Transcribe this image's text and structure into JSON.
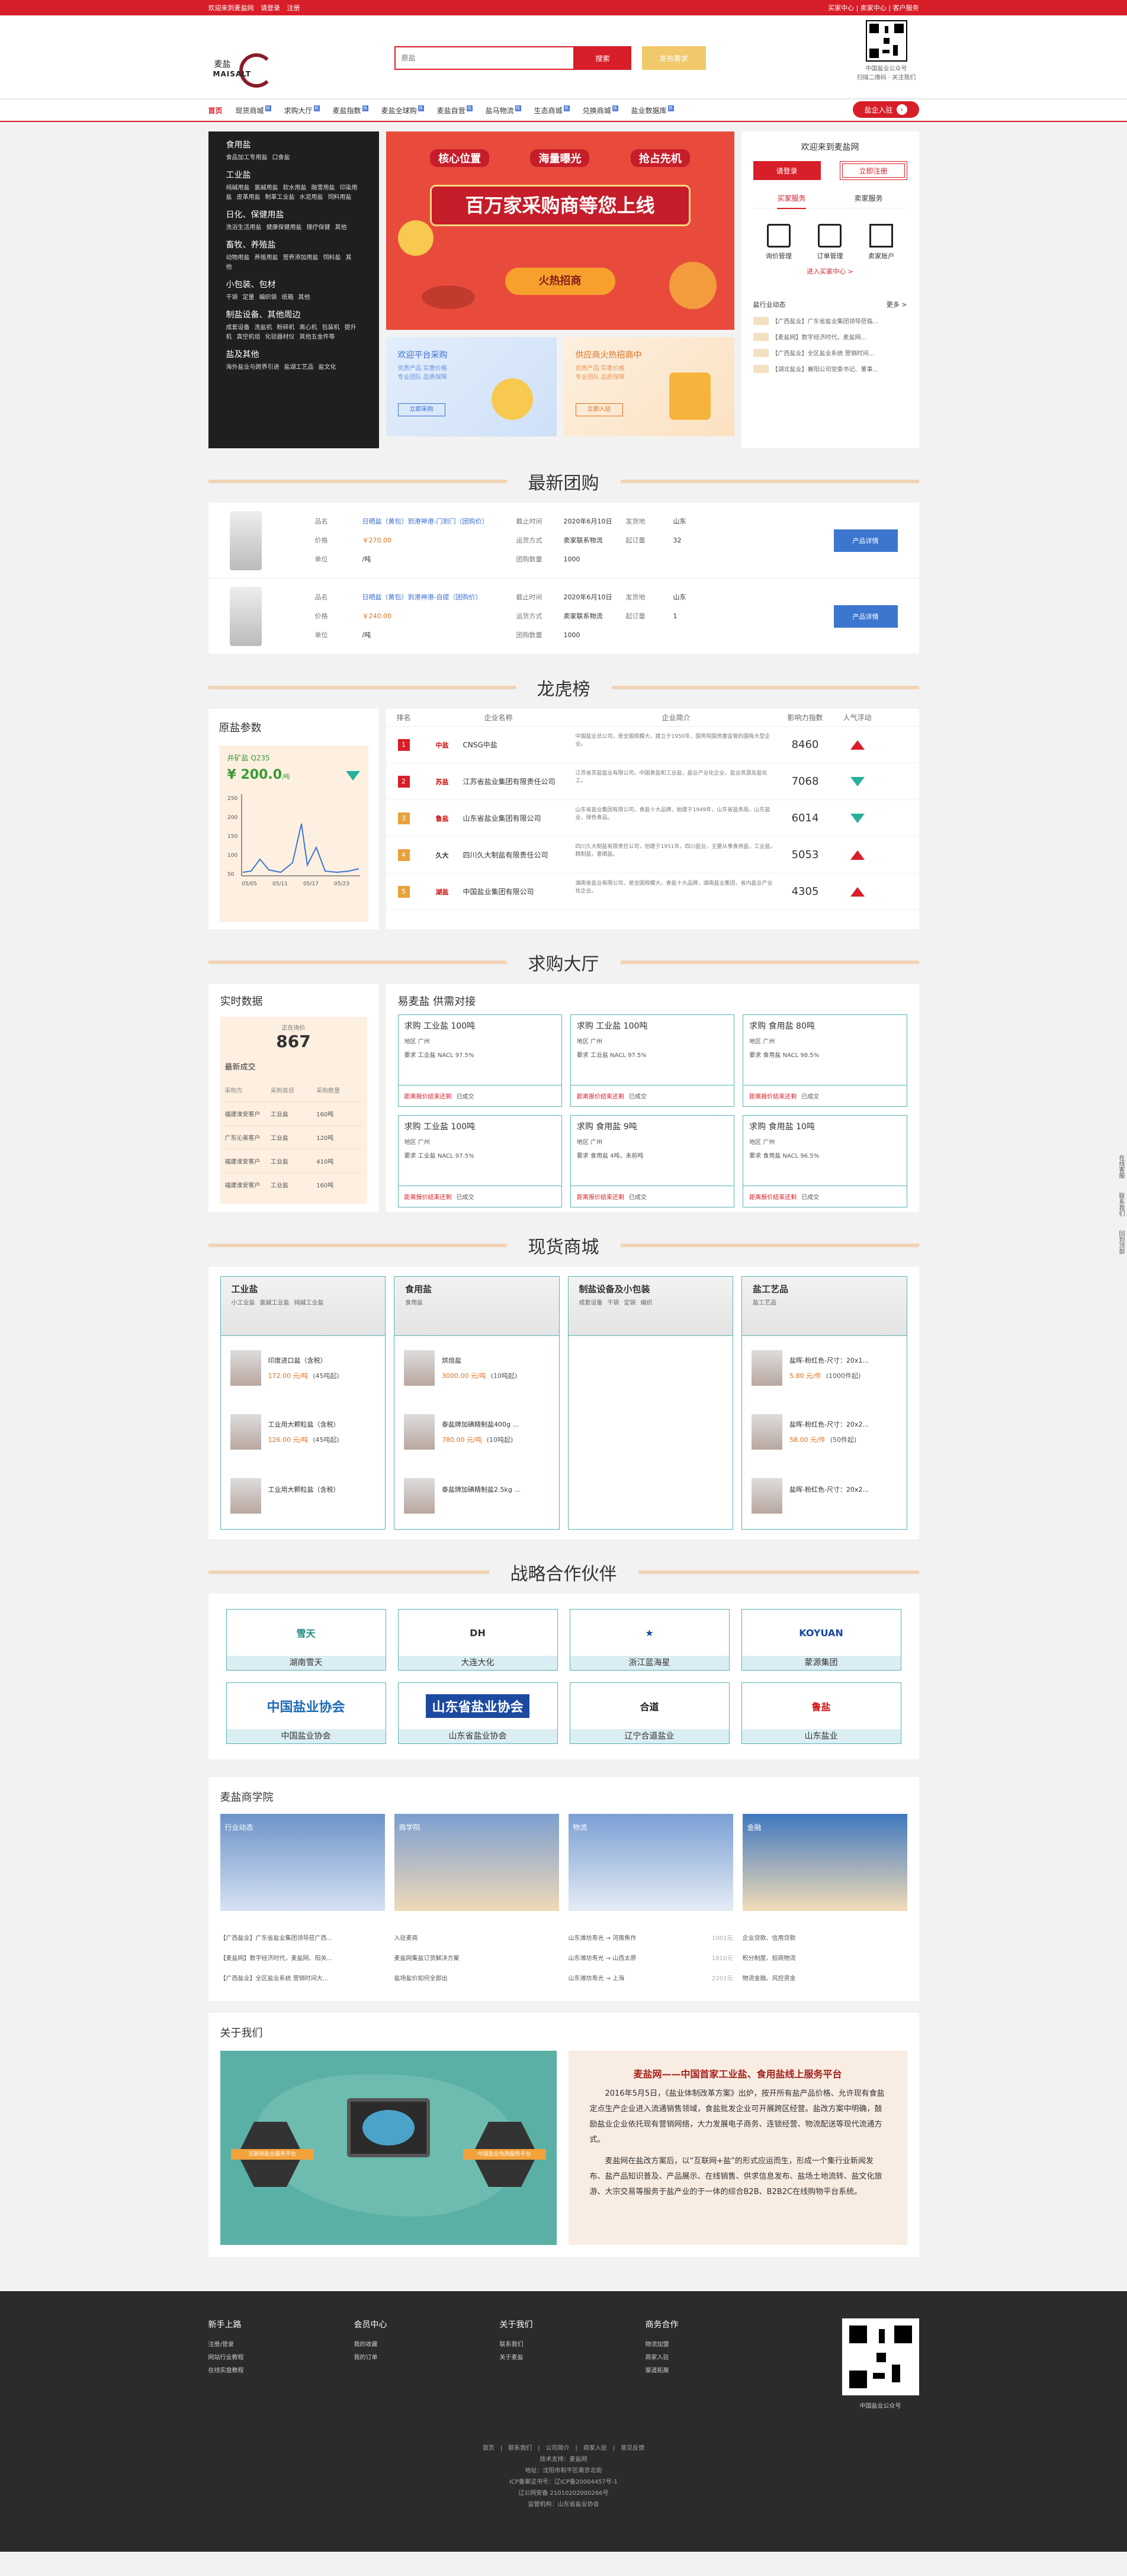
{
  "topbar": {
    "welcome": "欢迎来到麦盐网",
    "login": "请登录",
    "register": "注册",
    "right_links": "买家中心 | 卖家中心 | 客户服务"
  },
  "header": {
    "logo_cn": "麦盐",
    "logo_en": "MAISALT",
    "search_placeholder": "原盐",
    "search_btn": "搜索",
    "publish_btn": "发布需求",
    "qr_caption1": "中国盐业公众号",
    "qr_caption2": "扫描二维码 · 关注我们"
  },
  "nav": {
    "items": [
      "首页",
      "现货商城",
      "求购大厅",
      "麦盐指数",
      "麦盐全球购",
      "麦盐自营",
      "盐马物流",
      "生态商城",
      "兑换商城",
      "盐业数据库"
    ],
    "enter": "盐企入驻"
  },
  "categories": [
    {
      "h": "食用盐",
      "s": [
        "食品加工专用盐",
        "口食盐"
      ]
    },
    {
      "h": "工业盐",
      "s": [
        "纯碱用盐",
        "氯碱用盐",
        "软水用盐",
        "融雪用盐",
        "印染用盐",
        "皮革用盐",
        "制革工业盐",
        "水泥用盐",
        "饲料用盐"
      ]
    },
    {
      "h": "日化、保健用盐",
      "s": [
        "洗浴生活用盐",
        "健康保健用盐",
        "理疗保健",
        "其他"
      ]
    },
    {
      "h": "畜牧、养殖盐",
      "s": [
        "动物用盐",
        "养殖用盐",
        "营养添加用盐",
        "饲料盐",
        "其他"
      ]
    },
    {
      "h": "小包装、包材",
      "s": [
        "干袋",
        "定量",
        "编织袋",
        "纸箱",
        "其他"
      ]
    },
    {
      "h": "制盐设备、其他周边",
      "s": [
        "成套设备",
        "洗盐机",
        "粉碎机",
        "离心机",
        "包装机",
        "提升机",
        "真空机组",
        "化验器材仪",
        "其他五金件等"
      ]
    },
    {
      "h": "盐及其他",
      "s": [
        "海外盐业与跨界引进",
        "盐湖工艺品",
        "盐文化"
      ]
    }
  ],
  "banner": {
    "tag1": "核心位置",
    "tag2": "海量曝光",
    "tag3": "抢占先机",
    "title": "百万家采购商等您上线",
    "cta": "火热招商"
  },
  "subbanners": [
    {
      "t": "欢迎平台采购",
      "d1": "优质产品 实惠价格",
      "d2": "专业团队 品质保障",
      "b": "立即采购"
    },
    {
      "t": "供应商火热招商中",
      "d1": "优质产品 实惠价格",
      "d2": "专业团队 品质保障",
      "b": "立即入驻"
    }
  ],
  "userbox": {
    "welcome": "欢迎来到麦盐网",
    "login": "请登录",
    "register": "立即注册",
    "tab1": "买家服务",
    "tab2": "卖家服务",
    "icon1": "询价管理",
    "icon2": "订单管理",
    "icon3": "卖家账户",
    "enter": "进入买家中心 >",
    "platform": "盐行业动态",
    "more": "更多 >",
    "news": [
      "【广西盐业】广东省盐业集团领导莅临...",
      "【麦盐网】数字经济时代，麦盐网...",
      "【广西盐业】全区盐业系统 营销时间...",
      "【湖北盐业】襄阳公司党委书记、董事..."
    ]
  },
  "sections": {
    "group": "最新团购",
    "rank": "龙虎榜",
    "hall": "求购大厅",
    "mall": "现货商城",
    "partners": "战略合作伙伴"
  },
  "group_items": [
    {
      "name": "日晒盐（黄包）到港神港-门到门（团购价）",
      "price": "￥270.00",
      "unit": "/吨",
      "deadline": "2020年6月10日",
      "delivery": "卖家联系物流",
      "qty": "1000",
      "origin": "山东",
      "joined": "32",
      "btn": "产品详情"
    },
    {
      "name": "日晒盐（黄包）到港神港-自提（团购价）",
      "price": "￥240.00",
      "unit": "/吨",
      "deadline": "2020年6月10日",
      "delivery": "卖家联系物流",
      "qty": "1000",
      "origin": "山东",
      "joined": "1",
      "btn": "产品详情"
    }
  ],
  "group_labels": {
    "name": "品名",
    "price": "价格",
    "unit": "单位",
    "deadline": "截止时间",
    "delivery": "运货方式",
    "qty": "团购数量",
    "origin": "发货地",
    "joined": "起订量"
  },
  "raw": {
    "title": "原盐参数",
    "name": "井矿盐 Q235",
    "value": "¥ 200.0",
    "unit": "/吨",
    "y_ticks": [
      "250",
      "200",
      "150",
      "100",
      "50"
    ],
    "x_ticks": [
      "05/05",
      "05/11",
      "05/17",
      "05/23"
    ]
  },
  "rank_head": {
    "c1": "排名",
    "c2": "企业名称",
    "c3": "企业简介",
    "c4": "影响力指数",
    "c5": "人气浮动"
  },
  "rank_rows": [
    {
      "n": "1",
      "logo": "中盐",
      "name": "CNSG中盐",
      "desc": "中国盐业总公司，是全国规模大，建立于1950年，国务院国资委监管的国有大型企业。",
      "num": "8460",
      "dir": "up",
      "color": "#d81e28"
    },
    {
      "n": "2",
      "logo": "苏盐",
      "name": "江苏省盐业集团有限责任公司",
      "desc": "江苏省苏盐盐业有限公司，中国食盐和工业盐，盐业产业化企业，盐业资源及盐化工。",
      "num": "7068",
      "dir": "dn",
      "color": "#d81e28"
    },
    {
      "n": "3",
      "logo": "鲁盐",
      "name": "山东省盐业集团有限公司",
      "desc": "山东省盐业集团有限公司，食盐十大品牌，始建于1949年，山东省盐务局，山东盐业，绿色食品。",
      "num": "6014",
      "dir": "dn",
      "color": "#e9a23b"
    },
    {
      "n": "4",
      "logo": "久大",
      "name": "四川久大制盐有限责任公司",
      "desc": "四川久大制盐有限责任公司，创建于1951年，四川盐业，主要从事食用盐，工业盐，精制盐，富硒盐。",
      "num": "5053",
      "dir": "up",
      "color": "#e9a23b"
    },
    {
      "n": "5",
      "logo": "湖盐",
      "name": "中国盐业集团有限公司",
      "desc": "湖南省盐业有限公司，是全国规模大，食盐十大品牌，湖南盐业集团，省内盐业产业化企业。",
      "num": "4305",
      "dir": "up",
      "color": "#e9a23b"
    }
  ],
  "hall": {
    "stat_title": "实时数据",
    "stat_label": "正在询价",
    "stat_num": "867",
    "recent": "最新成交",
    "cols": [
      "采购方",
      "采购类目",
      "采购数量"
    ],
    "rows": [
      [
        "福建淮安客户",
        "工业盐",
        "160吨"
      ],
      [
        "广东沁美客户",
        "工业盐",
        "120吨"
      ],
      [
        "福建淮安客户",
        "工业盐",
        "410吨"
      ],
      [
        "福建淮安客户",
        "工业盐",
        "160吨"
      ]
    ],
    "grid_title": "易麦盐 供需对接",
    "cards": [
      {
        "h": "求购 工业盐 100吨",
        "l1": "地区 广州",
        "l2": "要求 工业盐 NACL 97.5%"
      },
      {
        "h": "求购 工业盐 100吨",
        "l1": "地区 广州",
        "l2": "要求 工业盐 NACL 97.5%"
      },
      {
        "h": "求购 食用盐 80吨",
        "l1": "地区 广州",
        "l2": "要求 食用盐 NACL 98.5%"
      },
      {
        "h": "求购 工业盐 100吨",
        "l1": "地区 广州",
        "l2": "要求 工业盐 NACL 97.5%"
      },
      {
        "h": "求购 食用盐 9吨",
        "l1": "地区 广州",
        "l2": "要求 食用盐 4吨，未前吨"
      },
      {
        "h": "求购 食用盐 10吨",
        "l1": "地区 广州",
        "l2": "要求 食用盐 NACL 96.5%"
      }
    ],
    "card_quote": "距离报价结束还剩",
    "card_deal": "已成交"
  },
  "mall": [
    {
      "h": "工业盐",
      "subs": [
        "小工业盐",
        "氯碱工业盐",
        "纯碱工业盐"
      ],
      "items": [
        {
          "n": "印度进口盐（含税）",
          "p": "172.00 元/吨",
          "q": "(45吨起)"
        },
        {
          "n": "工业用大颗粒盐（含税）",
          "p": "126.00 元/吨",
          "q": "(45吨起)"
        },
        {
          "n": "工业用大颗粒盐（含税）",
          "p": "",
          "q": ""
        }
      ]
    },
    {
      "h": "食用盐",
      "subs": [
        "食用盐"
      ],
      "items": [
        {
          "n": "烘焙盐",
          "p": "3000.00 元/吨",
          "q": "(10吨起)"
        },
        {
          "n": "泰盐牌加碘精制盐400g ...",
          "p": "780.00 元/吨",
          "q": "(10吨起)"
        },
        {
          "n": "泰盐牌加碘精制盐2.5kg ...",
          "p": "",
          "q": ""
        }
      ]
    },
    {
      "h": "制盐设备及小包装",
      "subs": [
        "成套设备",
        "干袋",
        "定袋",
        "编织"
      ],
      "items": []
    },
    {
      "h": "盐工艺品",
      "subs": [
        "盐工艺品"
      ],
      "items": [
        {
          "n": "盐晖-粉红色-尺寸：20x1...",
          "p": "5.80 元/件",
          "q": "(1000件起)"
        },
        {
          "n": "盐晖-粉红色-尺寸：20x2...",
          "p": "58.00 元/件",
          "q": "(50件起)"
        },
        {
          "n": "盐晖-粉红色-尺寸：20x2...",
          "p": "",
          "q": ""
        }
      ]
    }
  ],
  "partners": [
    "湖南雪天",
    "大连大化",
    "浙江蓝海星",
    "蒙源集团",
    "中国盐业协会",
    "山东省盐业协会",
    "辽宁合道盐业",
    "山东盐业"
  ],
  "partner_logos": [
    "雪天",
    "DH",
    "★",
    "KOYUAN",
    "中国盐业协会",
    "山东省盐业协会",
    "合道",
    "鲁盐"
  ],
  "academy": {
    "title": "麦盐商学院",
    "cols": [
      {
        "lb": "行业动态",
        "items": [
          [
            "【广西盐业】广东省盐业集团领导莅广西...",
            ""
          ],
          [
            "【麦盐网】数字经济时代，麦盐网、阳关...",
            ""
          ],
          [
            "【广西盐业】全区盐业系统 营销时间大...",
            ""
          ]
        ]
      },
      {
        "lb": "商学院",
        "items": [
          [
            "入驻麦商",
            ""
          ],
          [
            "麦盐网集盐订货解决方案",
            ""
          ],
          [
            "盐场盐价如何全部出",
            ""
          ]
        ]
      },
      {
        "lb": "物流",
        "items": [
          [
            "山东潍坊寿光 → 河南焦作",
            "1001元"
          ],
          [
            "山东潍坊寿光 → 山西太原",
            "1810元"
          ],
          [
            "山东潍坊寿光 → 上海",
            "2201元"
          ]
        ]
      },
      {
        "lb": "金融",
        "items": [
          [
            "企业贷款、信用贷款",
            ""
          ],
          [
            "积分制度、招商物流",
            ""
          ],
          [
            "物流金融、风控资金",
            ""
          ]
        ]
      }
    ]
  },
  "about": {
    "title": "关于我们",
    "head": "麦盐网——中国首家工业盐、食用盐线上服务平台",
    "p1": "2016年5月5日，《盐业体制改革方案》出炉，按开所有盐产品价格、允许现有食盐定点生产企业进入流通销售领域，食盐批发企业可开展跨区经营。盐改方案中明确，鼓励盐业企业依托现有营销网络，大力发展电子商务、连锁经营、物流配送等现代流通方式。",
    "p2": "麦盐网在盐改方案后，以“互联网+盐”的形式应运而生，形成一个集行业新闻发布、盐产品知识普及、产品展示、在线销售、供求信息发布、盐场土地流转、盐文化旅游、大宗交易等服务于盐产业的于一体的综合B2B、B2B2C在线购物平台系统。",
    "img_label1": "互联网盐业服务平台",
    "img_label2": "中国盐业电商服务平台"
  },
  "footer": {
    "cols": [
      {
        "h": "新手上路",
        "i": [
          "注册/登录",
          "网站行业教程",
          "在线实盘教程"
        ]
      },
      {
        "h": "会员中心",
        "i": [
          "我的收藏",
          "我的订单"
        ]
      },
      {
        "h": "关于我们",
        "i": [
          "联系我们",
          "关于麦盐"
        ]
      },
      {
        "h": "商务合作",
        "i": [
          "物流加盟",
          "商家入驻",
          "渠道拓展"
        ]
      }
    ],
    "qr_caption": "中国盐业公众号",
    "links": [
      "首页",
      "联系我们",
      "公司简介",
      "商家入驻",
      "意见反馈"
    ],
    "l1": "技术支持：麦盐网",
    "l2": "地址：沈阳市和平区南京北街",
    "l3": "ICP备案证书号：辽ICP备20004457号-1",
    "l4": "辽公网安备 21010202000266号",
    "l5": "监管机构：山东省盐业协会"
  },
  "side": [
    "在线客服",
    "联系我们",
    "回到顶部"
  ],
  "colors": {
    "brand": "#d81e28",
    "teal": "#56b4b4",
    "beige": "#f1d3b6"
  }
}
